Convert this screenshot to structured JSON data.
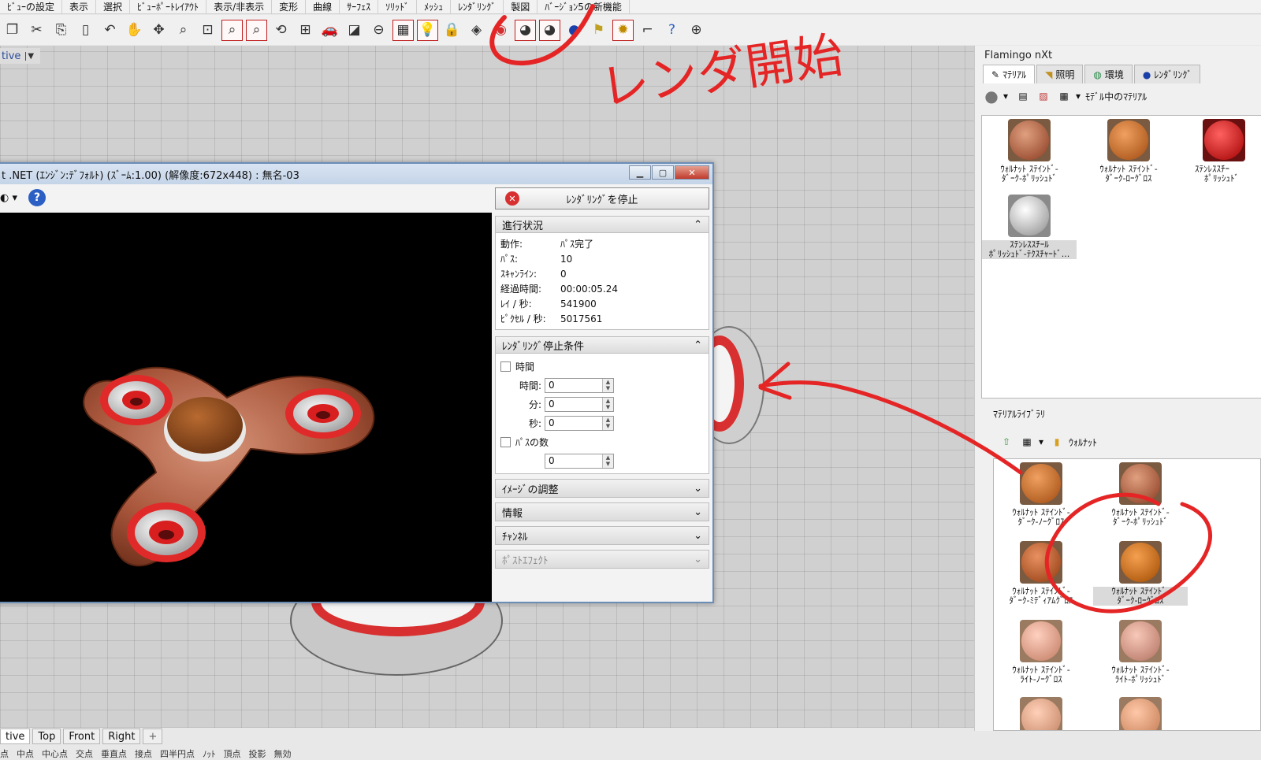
{
  "menu": [
    "ﾋﾞｭｰの設定",
    "表示",
    "選択",
    "ﾋﾞｭｰﾎﾟｰﾄﾚｲｱｳﾄ",
    "表示/非表示",
    "変形",
    "曲線",
    "ｻｰﾌｪｽ",
    "ｿﾘｯﾄﾞ",
    "ﾒｯｼｭ",
    "ﾚﾝﾀﾞﾘﾝｸﾞ",
    "製図",
    "ﾊﾞｰｼﾞｮﾝ5の新機能"
  ],
  "viewport": {
    "label": "tive"
  },
  "render_window": {
    "title": "t .NET (ｴﾝｼﾞﾝ:ﾃﾞﾌｫﾙﾄ) (ｽﾞｰﾑ:1.00) (解像度:672x448) : 無名-03",
    "stop_button": "ﾚﾝﾀﾞﾘﾝｸﾞを停止",
    "progress": {
      "header": "進行状況",
      "rows": [
        {
          "k": "動作:",
          "v": "ﾊﾟｽ完了"
        },
        {
          "k": "ﾊﾟｽ:",
          "v": "10"
        },
        {
          "k": "ｽｷｬﾝﾗｲﾝ:",
          "v": "0"
        },
        {
          "k": "経過時間:",
          "v": "00:00:05.24"
        },
        {
          "k": "ﾚｲ / 秒:",
          "v": "541900"
        },
        {
          "k": "ﾋﾟｸｾﾙ / 秒:",
          "v": "5017561"
        }
      ]
    },
    "stop_conditions": {
      "header": "ﾚﾝﾀﾞﾘﾝｸﾞ停止条件",
      "time_check": "時間",
      "time_label": "時間:",
      "time_value": "0",
      "min_label": "分:",
      "min_value": "0",
      "sec_label": "秒:",
      "sec_value": "0",
      "passes_check": "ﾊﾟｽの数",
      "passes_value": "0"
    },
    "collapsed": [
      "ｲﾒｰｼﾞの調整",
      "情報",
      "ﾁｬﾝﾈﾙ",
      "ﾎﾟｽﾄｴﾌｪｸﾄ"
    ]
  },
  "panel": {
    "title": "Flamingo nXt",
    "tabs": [
      "ﾏﾃﾘｱﾙ",
      "照明",
      "環境",
      "ﾚﾝﾀﾞﾘﾝｸﾞ"
    ],
    "model_dropdown": "ﾓﾃﾞﾙ中のﾏﾃﾘｱﾙ",
    "model_materials": [
      {
        "l1": "ｳｫﾙﾅｯﾄ ｽﾃｲﾝﾄﾞ-",
        "l2": "ﾀﾞｰｸ-ﾎﾟﾘｯｼｭﾄﾞ"
      },
      {
        "l1": "ｳｫﾙﾅｯﾄ ｽﾃｲﾝﾄﾞ-",
        "l2": "ﾀﾞｰｸ-ﾛｰｸﾞﾛｽ"
      },
      {
        "l1": "ｽﾃﾝﾚｽｽﾁｰ",
        "l2": "ﾎﾟﾘｯｼｭﾄﾞ"
      },
      {
        "l1": "ｽﾃﾝﾚｽｽﾁｰﾙ",
        "l2": "ﾎﾟﾘｯｼｭﾄﾞ-ﾃｸｽﾁｬｰﾄﾞ..."
      }
    ],
    "library_title": "ﾏﾃﾘｱﾙﾗｲﾌﾞﾗﾘ",
    "library_folder": "ｳｫﾙﾅｯﾄ",
    "library_materials": [
      {
        "l1": "ｳｫﾙﾅｯﾄ ｽﾃｲﾝﾄﾞ-",
        "l2": "ﾀﾞｰｸ-ﾉｰｸﾞﾛｽ"
      },
      {
        "l1": "ｳｫﾙﾅｯﾄ ｽﾃｲﾝﾄﾞ-",
        "l2": "ﾀﾞｰｸ-ﾎﾟﾘｯｼｭﾄﾞ"
      },
      {
        "l1": "ｳｫﾙﾅｯﾄ ｽﾃｲﾝﾄﾞ-",
        "l2": "ﾀﾞｰｸ-ﾐﾃﾞｨｱﾑｸﾞﾛｽ"
      },
      {
        "l1": "ｳｫﾙﾅｯﾄ ｽﾃｲﾝﾄﾞ-",
        "l2": "ﾀﾞｰｸ-ﾛｰｸﾞﾛｽ"
      },
      {
        "l1": "ｳｫﾙﾅｯﾄ ｽﾃｲﾝﾄﾞ-",
        "l2": "ﾗｲﾄ-ﾉｰｸﾞﾛｽ"
      },
      {
        "l1": "ｳｫﾙﾅｯﾄ ｽﾃｲﾝﾄﾞ-",
        "l2": "ﾗｲﾄ-ﾎﾟﾘｯｼｭﾄﾞ"
      }
    ]
  },
  "view_tabs": [
    "tive",
    "Top",
    "Front",
    "Right",
    "+"
  ],
  "snap_bar": [
    "点",
    "中点",
    "中心点",
    "交点",
    "垂直点",
    "接点",
    "四半円点",
    "ﾉｯﾄ",
    "頂点",
    "投影",
    "無効"
  ],
  "annotation": {
    "text": "レンダ開始"
  },
  "colors": {
    "annotation_red": "#e52525",
    "viewport_bg": "#d0d0d0",
    "panel_bg": "#f0f0f0"
  }
}
